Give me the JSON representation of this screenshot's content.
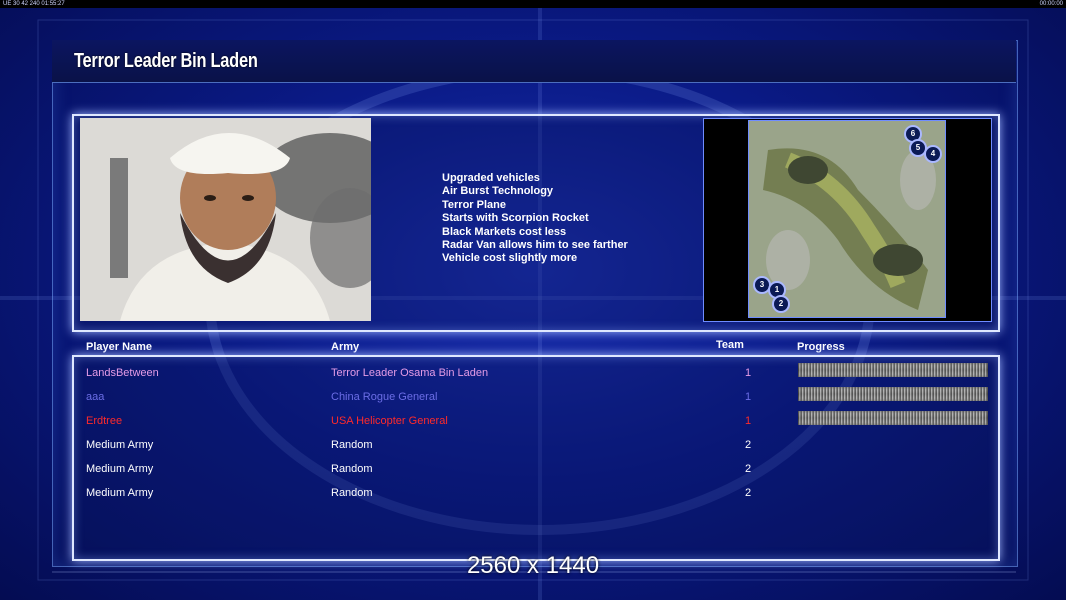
{
  "topbar": {
    "left_text": "UE 30 42 240 01:55:27",
    "right_text": "00:00:00"
  },
  "general": {
    "title": "Terror Leader Bin Laden",
    "bonuses": [
      "Upgraded vehicles",
      "Air Burst Technology",
      "Terror Plane",
      "Starts with Scorpion Rocket",
      "Black Markets cost less",
      "Radar Van allows him to see farther",
      "Vehicle cost slightly more"
    ]
  },
  "map": {
    "start_positions": [
      "6",
      "5",
      "4",
      "3",
      "1",
      "2"
    ]
  },
  "table": {
    "headers": {
      "player": "Player Name",
      "army": "Army",
      "team": "Team",
      "progress": "Progress"
    },
    "rows": [
      {
        "name": "LandsBetween",
        "army": "Terror Leader Osama Bin Laden",
        "team": "1",
        "color": "#e59ce6",
        "progress": 1.0
      },
      {
        "name": "aaa",
        "army": "China Rogue General",
        "team": "1",
        "color": "#6b6de6",
        "progress": 1.0
      },
      {
        "name": "Erdtree",
        "army": "USA Helicopter General",
        "team": "1",
        "color": "#ff2a2a",
        "progress": 1.0
      },
      {
        "name": "Medium Army",
        "army": "Random",
        "team": "2",
        "color": "#ffffff"
      },
      {
        "name": "Medium Army",
        "army": "Random",
        "team": "2",
        "color": "#ffffff"
      },
      {
        "name": "Medium Army",
        "army": "Random",
        "team": "2",
        "color": "#ffffff"
      }
    ]
  },
  "resolution_label": "2560 x 1440"
}
